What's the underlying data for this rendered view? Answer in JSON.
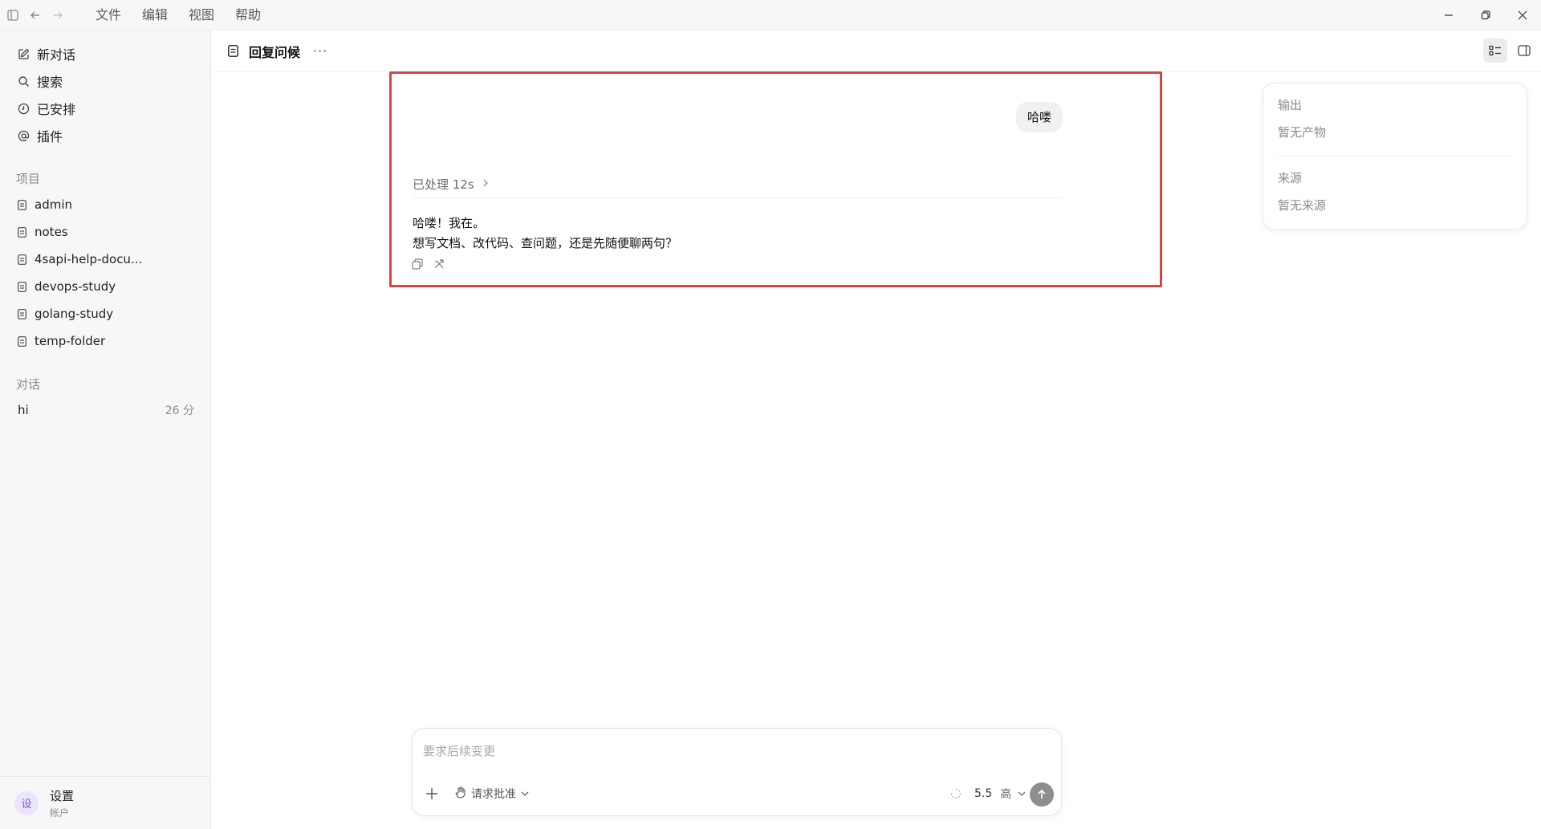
{
  "menubar": {
    "items": [
      "文件",
      "编辑",
      "视图",
      "帮助"
    ]
  },
  "sidebar": {
    "nav": [
      {
        "label": "新对话",
        "icon": "edit-icon"
      },
      {
        "label": "搜索",
        "icon": "search-icon"
      },
      {
        "label": "已安排",
        "icon": "clock-icon"
      },
      {
        "label": "插件",
        "icon": "at-icon"
      }
    ],
    "projects_label": "项目",
    "projects": [
      "admin",
      "notes",
      "4sapi-help-docu...",
      "devops-study",
      "golang-study",
      "temp-folder"
    ],
    "conversations_label": "对话",
    "conversations": [
      {
        "title": "hi",
        "time": "26 分"
      }
    ],
    "footer": {
      "avatar": "设",
      "title": "设置",
      "subtitle": "帐户"
    }
  },
  "header": {
    "title": "回复问候",
    "more": "···"
  },
  "chat": {
    "user_message": "哈喽",
    "processed": "已处理 12s",
    "reply_line1": "哈喽！我在。",
    "reply_line2": "想写文档、改代码、查问题，还是先随便聊两句？"
  },
  "right_panel": {
    "output_label": "输出",
    "output_value": "暂无产物",
    "sources_label": "来源",
    "sources_value": "暂无来源"
  },
  "composer": {
    "placeholder": "要求后续变更",
    "approval": "请求批准",
    "model": "5.5",
    "level": "高"
  },
  "colors": {
    "highlight": "#d9443d",
    "sidebar_bg": "#f7f7f7",
    "send_button": "#8e8e8e"
  }
}
